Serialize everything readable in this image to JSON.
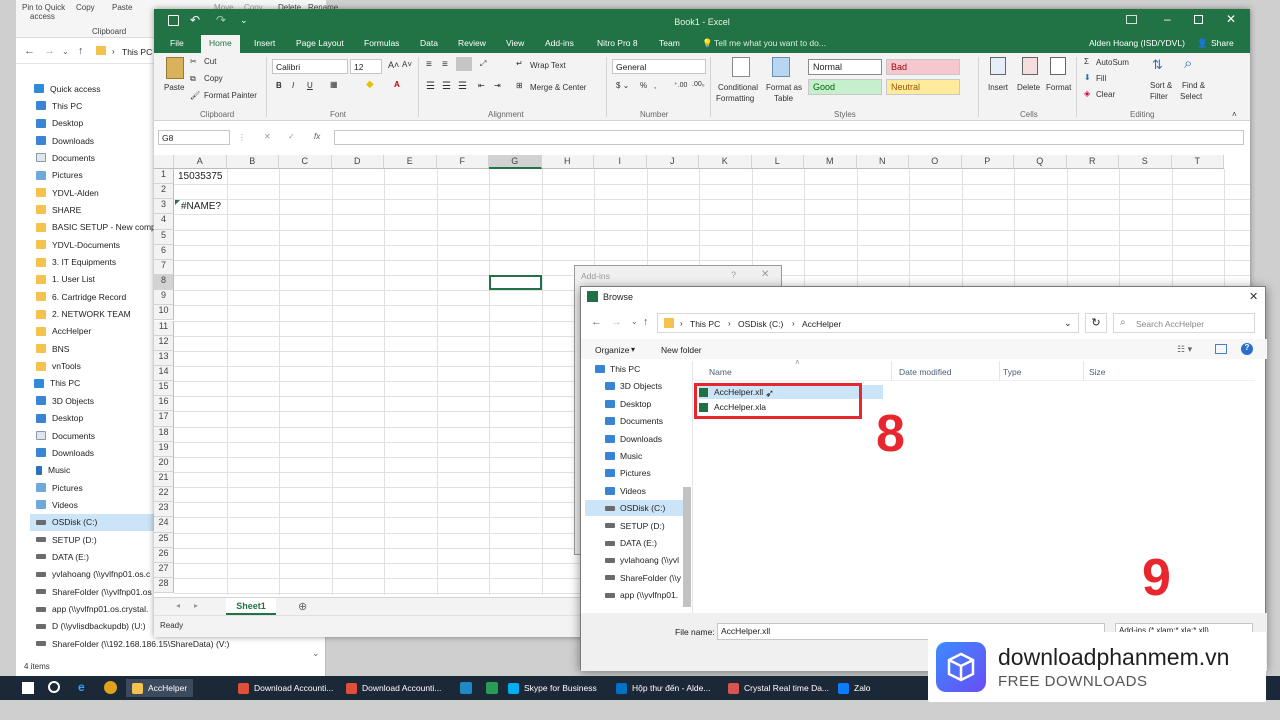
{
  "explorer": {
    "ribbon": [
      "Pin to Quick",
      "access",
      "Copy",
      "Paste",
      "Clipboard",
      "Move",
      "Copy",
      "Delete",
      "Rename",
      "New",
      "Properties"
    ],
    "address": "This PC",
    "nav": [
      {
        "label": "Quick access",
        "icon": "star-icon"
      },
      {
        "label": "This PC",
        "icon": "computer-icon"
      },
      {
        "label": "Desktop",
        "icon": "desktop-icon"
      },
      {
        "label": "Downloads",
        "icon": "download-icon"
      },
      {
        "label": "Documents",
        "icon": "document-icon"
      },
      {
        "label": "Pictures",
        "icon": "pictures-icon"
      },
      {
        "label": "YDVL-Alden",
        "icon": "folder-icon"
      },
      {
        "label": "SHARE",
        "icon": "folder-icon"
      },
      {
        "label": "BASIC SETUP - New comp",
        "icon": "folder-icon"
      },
      {
        "label": "YDVL-Documents",
        "icon": "folder-icon"
      },
      {
        "label": "3. IT Equipments",
        "icon": "folder-icon"
      },
      {
        "label": "1. User List",
        "icon": "folder-icon"
      },
      {
        "label": "6. Cartridge Record",
        "icon": "folder-icon"
      },
      {
        "label": "2. NETWORK TEAM",
        "icon": "folder-icon"
      },
      {
        "label": "AccHelper",
        "icon": "folder-icon"
      },
      {
        "label": "BNS",
        "icon": "folder-icon"
      },
      {
        "label": "vnTools",
        "icon": "folder-icon"
      },
      {
        "label": "This PC",
        "icon": "computer-icon"
      },
      {
        "label": "3D Objects",
        "icon": "objects-icon"
      },
      {
        "label": "Desktop",
        "icon": "desktop-icon"
      },
      {
        "label": "Documents",
        "icon": "document-icon"
      },
      {
        "label": "Downloads",
        "icon": "download-icon"
      },
      {
        "label": "Music",
        "icon": "music-icon"
      },
      {
        "label": "Pictures",
        "icon": "pictures-icon"
      },
      {
        "label": "Videos",
        "icon": "video-icon"
      },
      {
        "label": "OSDisk (C:)",
        "icon": "drive-icon"
      },
      {
        "label": "SETUP (D:)",
        "icon": "drive-icon"
      },
      {
        "label": "DATA (E:)",
        "icon": "drive-icon"
      },
      {
        "label": "yvlahoang (\\\\yvlfnp01.os.c",
        "icon": "network-drive-icon"
      },
      {
        "label": "ShareFolder (\\\\yvlfnp01.os",
        "icon": "network-drive-icon"
      },
      {
        "label": "app (\\\\yvlfnp01.os.crystal.",
        "icon": "network-drive-icon"
      },
      {
        "label": "D (\\\\yvlisdbackupdb) (U:)",
        "icon": "network-drive-icon"
      },
      {
        "label": "ShareFolder (\\\\192.168.186.15\\ShareData) (V:)",
        "icon": "network-drive-icon"
      }
    ],
    "status": "4 items"
  },
  "excel": {
    "title": "Book1 - Excel",
    "user": "Alden Hoang (ISD/YDVL)",
    "share": "Share",
    "tabs": [
      "File",
      "Home",
      "Insert",
      "Page Layout",
      "Formulas",
      "Data",
      "Review",
      "View",
      "Add-ins",
      "Nitro Pro 8",
      "Team"
    ],
    "tell_me": "Tell me what you want to do...",
    "ribbon": {
      "paste": "Paste",
      "cut": "Cut",
      "copy": "Copy",
      "format_painter": "Format Painter",
      "font": "Calibri",
      "font_size": "12",
      "wrap_text": "Wrap Text",
      "merge_center": "Merge & Center",
      "number_format": "General",
      "conditional": "Conditional",
      "formatting": "Formatting",
      "format_as": "Format as",
      "table": "Table",
      "styles": {
        "normal": "Normal",
        "bad": "Bad",
        "good": "Good",
        "neutral": "Neutral"
      },
      "insert": "Insert",
      "delete": "Delete",
      "format": "Format",
      "autosum": "AutoSum",
      "fill": "Fill",
      "clear": "Clear",
      "sort_filter": "Sort &",
      "filter": "Filter",
      "find": "Find &",
      "select": "Select",
      "groups": [
        "Clipboard",
        "Font",
        "Alignment",
        "Number",
        "Styles",
        "Cells",
        "Editing"
      ]
    },
    "name_box": "G8",
    "columns": [
      "A",
      "B",
      "C",
      "D",
      "E",
      "F",
      "G",
      "H",
      "I",
      "J",
      "K",
      "L",
      "M",
      "N",
      "O",
      "P",
      "Q",
      "R",
      "S",
      "T"
    ],
    "cells": {
      "A1": "15035375",
      "A3": "#NAME?"
    },
    "sheet_tab": "Sheet1",
    "status": "Ready"
  },
  "addins_dialog": {
    "title": "Add-ins",
    "help": "?"
  },
  "browse_dialog": {
    "title": "Browse",
    "path": [
      "This PC",
      "OSDisk (C:)",
      "AccHelper"
    ],
    "search_placeholder": "Search AccHelper",
    "organize": "Organize",
    "new_folder": "New folder",
    "tree": [
      {
        "label": "This PC",
        "icon": "computer-icon"
      },
      {
        "label": "3D Objects",
        "icon": "objects-icon"
      },
      {
        "label": "Desktop",
        "icon": "desktop-icon"
      },
      {
        "label": "Documents",
        "icon": "document-icon"
      },
      {
        "label": "Downloads",
        "icon": "download-icon"
      },
      {
        "label": "Music",
        "icon": "music-icon"
      },
      {
        "label": "Pictures",
        "icon": "pictures-icon"
      },
      {
        "label": "Videos",
        "icon": "video-icon"
      },
      {
        "label": "OSDisk (C:)",
        "icon": "drive-icon"
      },
      {
        "label": "SETUP (D:)",
        "icon": "drive-icon"
      },
      {
        "label": "DATA (E:)",
        "icon": "drive-icon"
      },
      {
        "label": "yvlahoang (\\\\yvl",
        "icon": "network-drive-icon"
      },
      {
        "label": "ShareFolder (\\\\y",
        "icon": "network-drive-icon"
      },
      {
        "label": "app (\\\\yvlfnp01.",
        "icon": "network-drive-icon"
      }
    ],
    "columns": [
      "Name",
      "Date modified",
      "Type",
      "Size"
    ],
    "files": [
      "AccHelper.xll",
      "AccHelper.xla"
    ],
    "file_name_label": "File name:",
    "file_name_value": "AccHelper.xll",
    "file_type": "Add-ins (*.xlam;*.xla;*.xll)"
  },
  "annotations": {
    "step8": "8",
    "step9": "9"
  },
  "taskbar": [
    {
      "label": "AccHelper",
      "icon": "folder-icon"
    },
    {
      "label": "Download Accounti...",
      "icon": "browser-icon"
    },
    {
      "label": "Download Accounti...",
      "icon": "browser-icon"
    },
    {
      "label": "Skype for Business",
      "icon": "skype-icon"
    },
    {
      "label": "Hộp thư đến - Alde...",
      "icon": "outlook-icon"
    },
    {
      "label": "Crystal Real time Da...",
      "icon": "app-icon"
    },
    {
      "label": "Zalo",
      "icon": "zalo-icon"
    }
  ],
  "watermark": {
    "title": "downloadphanmem.vn",
    "subtitle": "FREE DOWNLOADS"
  },
  "colors": {
    "excel_green": "#217346",
    "annotation_red": "#e8262d"
  }
}
